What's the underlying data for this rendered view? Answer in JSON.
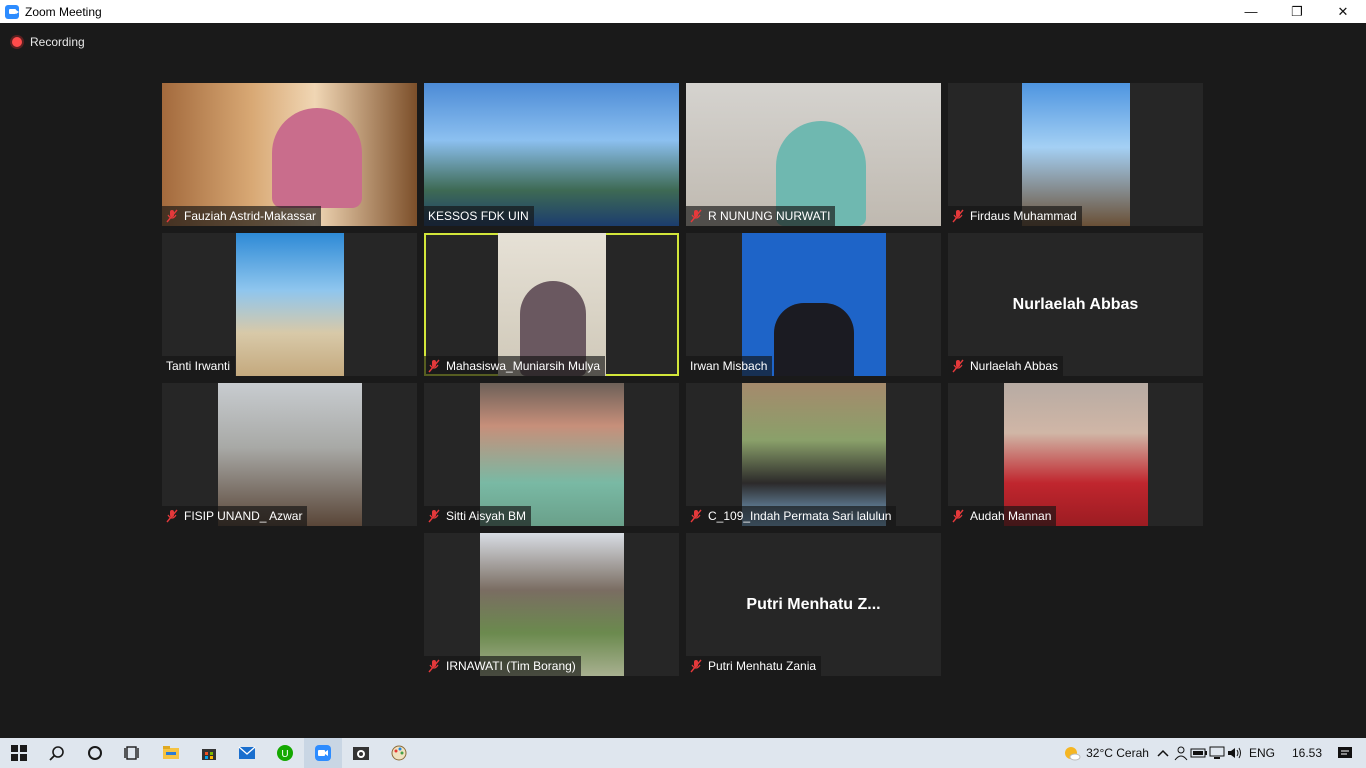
{
  "window": {
    "title": "Zoom Meeting"
  },
  "controls": {
    "minimize": "—",
    "restore": "❐",
    "close": "✕"
  },
  "recording": {
    "label": "Recording"
  },
  "participants": [
    {
      "name": "Fauziah Astrid-Makassar",
      "muted": true
    },
    {
      "name": "KESSOS FDK UIN",
      "muted": false
    },
    {
      "name": "R NUNUNG NURWATI",
      "muted": true
    },
    {
      "name": "Firdaus Muhammad",
      "muted": true
    },
    {
      "name": "Tanti Irwanti",
      "muted": false
    },
    {
      "name": "Mahasiswa_Muniarsih Mulya",
      "muted": true,
      "active_speaker": true
    },
    {
      "name": "Irwan Misbach",
      "muted": false
    },
    {
      "name": "Nurlaelah Abbas",
      "muted": true,
      "video_off_label": "Nurlaelah Abbas"
    },
    {
      "name": "FISIP UNAND_ Azwar",
      "muted": true
    },
    {
      "name": "Sitti Aisyah BM",
      "muted": true
    },
    {
      "name": "C_109_Indah Permata Sari lalulun",
      "muted": true
    },
    {
      "name": "Audah Mannan",
      "muted": true
    },
    {
      "name": "IRNAWATI (Tim Borang)",
      "muted": true
    },
    {
      "name": "Putri Menhatu Zania",
      "muted": true,
      "video_off_label": "Putri Menhatu Z..."
    }
  ],
  "taskbar": {
    "icons": [
      "windows-start-icon",
      "search-icon",
      "cortana-icon",
      "task-view-icon",
      "file-explorer-icon",
      "store-icon",
      "mail-icon",
      "upwork-icon",
      "zoom-icon",
      "camera-app-icon",
      "paint-icon"
    ],
    "weather": "32°C Cerah",
    "language": "ENG",
    "time": "16.53"
  },
  "colors": {
    "active_border": "#d2e63a",
    "muted_icon": "#e5393b",
    "tile_bg": "#262626",
    "recording_dot": "#ff4b4b"
  }
}
